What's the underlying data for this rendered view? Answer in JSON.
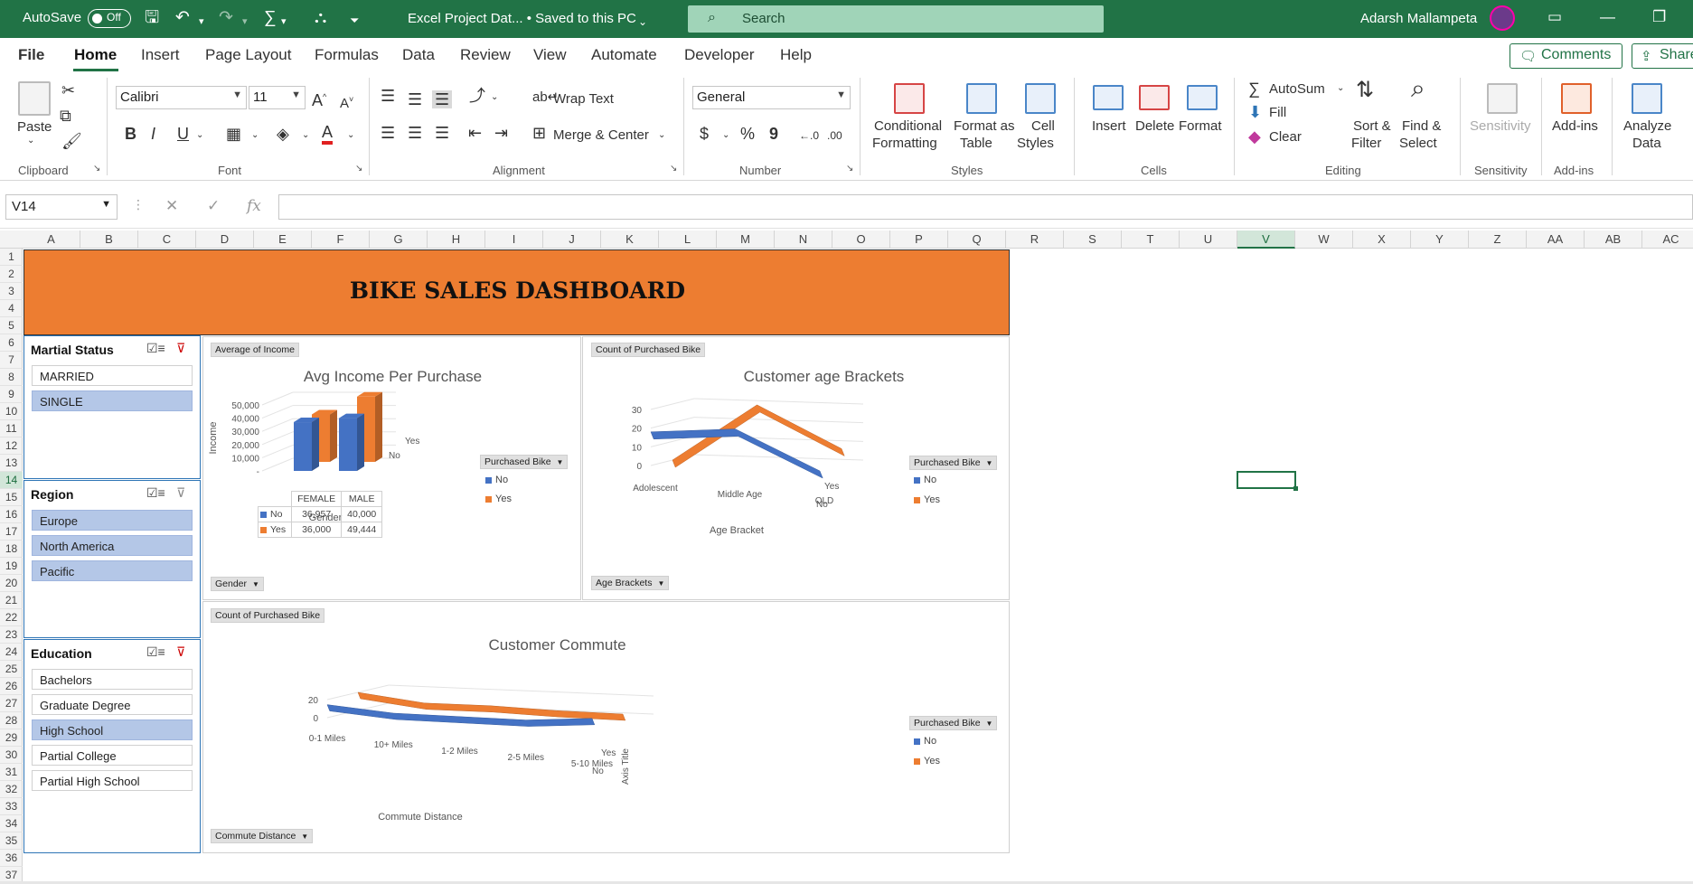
{
  "titlebar": {
    "autosave_label": "AutoSave",
    "autosave_state": "Off",
    "doc_title": "Excel Project Dat...  •  Saved to this PC",
    "search_placeholder": "Search",
    "user_name": "Adarsh Mallampeta"
  },
  "tabs": [
    "File",
    "Home",
    "Insert",
    "Page Layout",
    "Formulas",
    "Data",
    "Review",
    "View",
    "Automate",
    "Developer",
    "Help"
  ],
  "tab_actions": {
    "comments": "Comments",
    "share": "Share"
  },
  "ribbon": {
    "paste": "Paste",
    "font_name": "Calibri",
    "font_size": "11",
    "wrap_text": "Wrap Text",
    "merge_center": "Merge & Center",
    "number_format": "General",
    "conditional_formatting": [
      "Conditional",
      "Formatting"
    ],
    "format_as_table": [
      "Format as",
      "Table"
    ],
    "cell_styles": [
      "Cell",
      "Styles"
    ],
    "insert": "Insert",
    "delete": "Delete",
    "format": "Format",
    "autosum": "AutoSum",
    "fill": "Fill",
    "clear": "Clear",
    "sort_filter": [
      "Sort &",
      "Filter"
    ],
    "find_select": [
      "Find &",
      "Select"
    ],
    "sensitivity": "Sensitivity",
    "add_ins": "Add-ins",
    "analyze_data": [
      "Analyze",
      "Data"
    ],
    "groups": {
      "clipboard": "Clipboard",
      "font": "Font",
      "alignment": "Alignment",
      "number": "Number",
      "styles": "Styles",
      "cells": "Cells",
      "editing": "Editing",
      "sensitivity": "Sensitivity",
      "add_ins": "Add-ins"
    }
  },
  "formula_bar": {
    "name_box": "V14",
    "formula": ""
  },
  "columns": [
    "A",
    "B",
    "C",
    "D",
    "E",
    "F",
    "G",
    "H",
    "I",
    "J",
    "K",
    "L",
    "M",
    "N",
    "O",
    "P",
    "Q",
    "R",
    "S",
    "T",
    "U",
    "V",
    "W",
    "X",
    "Y",
    "Z",
    "AA",
    "AB",
    "AC"
  ],
  "selected_column": "V",
  "rows": [
    "1",
    "2",
    "3",
    "4",
    "5",
    "6",
    "7",
    "8",
    "9",
    "10",
    "11",
    "12",
    "13",
    "14",
    "15",
    "16",
    "17",
    "18",
    "19",
    "20",
    "21",
    "22",
    "23",
    "24",
    "25",
    "26",
    "27",
    "28",
    "29",
    "30",
    "31",
    "32",
    "33",
    "34",
    "35",
    "36",
    "37"
  ],
  "selected_row": "14",
  "dashboard": {
    "title": "BIKE SALES DASHBOARD"
  },
  "slicers": {
    "marital": {
      "title": "Martial Status",
      "items": [
        "MARRIED",
        "SINGLE"
      ],
      "selected": [
        false,
        true
      ]
    },
    "region": {
      "title": "Region",
      "items": [
        "Europe",
        "North America",
        "Pacific"
      ],
      "selected": [
        true,
        true,
        true
      ]
    },
    "education": {
      "title": "Education",
      "items": [
        "Bachelors",
        "Graduate Degree",
        "High School",
        "Partial College",
        "Partial High School"
      ],
      "selected": [
        false,
        false,
        true,
        false,
        false
      ]
    }
  },
  "charts": {
    "income": {
      "value_field": "Average of Income",
      "axis_field": "Gender",
      "legend_field": "Purchased Bike",
      "depth_labels": [
        "Yes",
        "No"
      ]
    },
    "age": {
      "value_field": "Count of Purchased Bike",
      "axis_field": "Age Brackets",
      "legend_field": "Purchased Bike",
      "depth_labels": [
        "Yes",
        "No"
      ]
    },
    "commute": {
      "value_field": "Count of Purchased Bike",
      "axis_field": "Commute Distance",
      "legend_field": "Purchased Bike",
      "depth_labels": [
        "Yes",
        "No"
      ],
      "depth_axis_title": "Axis Title"
    }
  },
  "colors": {
    "excel_green": "#217346",
    "no": "#4472c4",
    "yes": "#ed7d31",
    "banner": "#ed7d31"
  },
  "chart_data": [
    {
      "type": "bar",
      "title": "Avg Income Per Purchase",
      "xlabel": "Gender",
      "ylabel": "Income",
      "categories": [
        "FEMALE",
        "MALE"
      ],
      "series": [
        {
          "name": "No",
          "values": [
            36957,
            40000
          ],
          "color": "#4472c4"
        },
        {
          "name": "Yes",
          "values": [
            36000,
            49444
          ],
          "color": "#ed7d31"
        }
      ],
      "yticks": [
        "50,000",
        "40,000",
        "30,000",
        "20,000",
        "10,000",
        "-"
      ],
      "ylim": [
        0,
        50000
      ],
      "legend": "right",
      "data_table": true
    },
    {
      "type": "line",
      "title": "Customer age Brackets",
      "xlabel": "Age Bracket",
      "categories": [
        "Adolescent",
        "Middle Age",
        "OLD"
      ],
      "series": [
        {
          "name": "No",
          "values": [
            18,
            21,
            0
          ],
          "color": "#4472c4"
        },
        {
          "name": "Yes",
          "values": [
            0,
            31,
            9
          ],
          "color": "#ed7d31"
        }
      ],
      "yticks": [
        "30",
        "20",
        "10",
        "0"
      ],
      "ylim": [
        0,
        30
      ],
      "legend": "right"
    },
    {
      "type": "line",
      "title": "Customer Commute",
      "xlabel": "Commute Distance",
      "categories": [
        "0-1 Miles",
        "10+ Miles",
        "1-2 Miles",
        "2-5 Miles",
        "5-10 Miles"
      ],
      "series": [
        {
          "name": "No",
          "values": [
            18,
            10,
            9,
            8,
            14
          ],
          "color": "#4472c4"
        },
        {
          "name": "Yes",
          "values": [
            25,
            14,
            14,
            11,
            10
          ],
          "color": "#ed7d31"
        }
      ],
      "yticks": [
        "20",
        "0"
      ],
      "ylim": [
        0,
        25
      ],
      "legend": "right"
    }
  ]
}
